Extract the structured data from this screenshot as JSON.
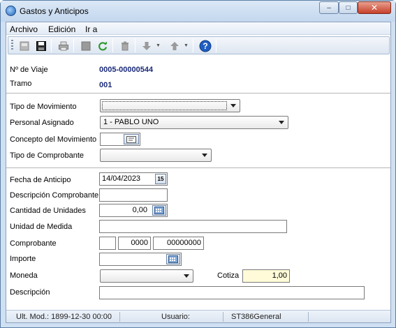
{
  "window": {
    "title": "Gastos y Anticipos",
    "minimize_glyph": "–",
    "maximize_glyph": "□",
    "close_glyph": "✕"
  },
  "menu": [
    "Archivo",
    "Edición",
    "Ir a"
  ],
  "toolbar": {
    "icons": [
      "new-icon",
      "save-icon",
      "print-icon",
      "stop-icon",
      "refresh-icon",
      "delete-icon",
      "down-arrow-icon",
      "up-arrow-icon",
      "help-icon"
    ],
    "help_glyph": "?"
  },
  "header": {
    "viaje_label": "Nº de Viaje",
    "viaje_value": "0005-00000544",
    "tramo_label": "Tramo",
    "tramo_value": "001"
  },
  "movement": {
    "tipo_label": "Tipo de Movimiento",
    "tipo_value": "",
    "personal_label": "Personal Asignado",
    "personal_value": "1 - PABLO UNO",
    "concepto_label": "Concepto del Movimiento",
    "concepto_value": "",
    "comprobante_tipo_label": "Tipo de Comprobante",
    "comprobante_tipo_value": ""
  },
  "detail": {
    "fecha_label": "Fecha de Anticipo",
    "fecha_value": "14/04/2023",
    "calendar_glyph": "15",
    "descripcion_comp_label": "Descripción Comprobante",
    "descripcion_comp_value": "",
    "cantidad_label": "Cantidad de Unidades",
    "cantidad_value": "0,00",
    "unidad_label": "Unidad de Medida",
    "unidad_value": "",
    "comprobante_label": "Comprobante",
    "comprobante_letra": "",
    "comprobante_punto": "0000",
    "comprobante_numero": "00000000",
    "importe_label": "Importe",
    "importe_value": "",
    "moneda_label": "Moneda",
    "moneda_value": "",
    "cotiza_label": "Cotiza",
    "cotiza_value": "1,00",
    "descripcion_label": "Descripción",
    "descripcion_value": ""
  },
  "status": {
    "ult_mod": "Ult. Mod.: 1899-12-30 00:00",
    "usuario_label": "Usuario:",
    "usuario_value": "ST386General"
  },
  "colors": {
    "accent": "#1a2a7a",
    "cotiza_bg": "#fffbd8",
    "title_bg": "#cfe0f3",
    "close_button": "#c7402a"
  }
}
